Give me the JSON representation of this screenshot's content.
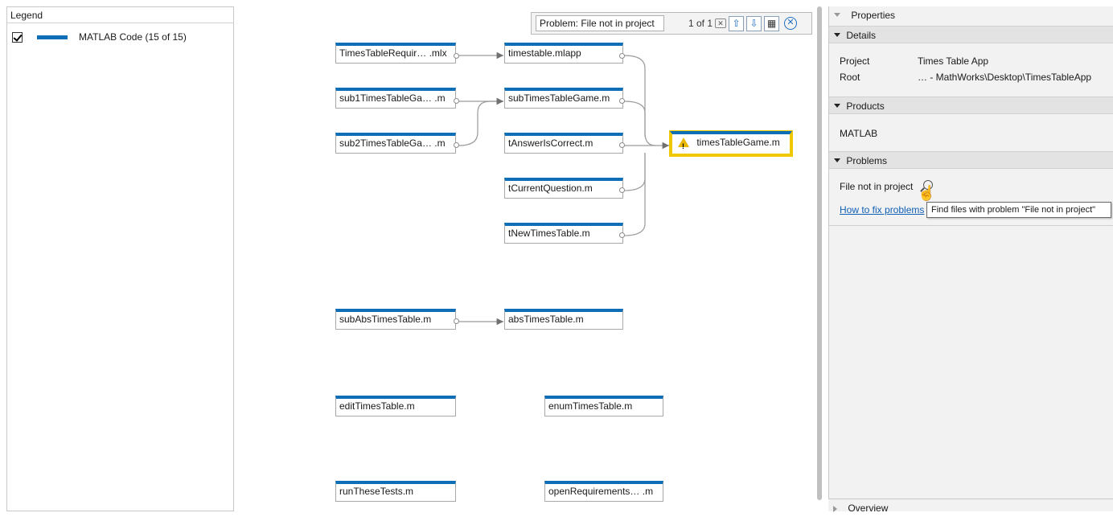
{
  "legend": {
    "title": "Legend",
    "items": [
      {
        "label": "MATLAB Code (15 of 15)",
        "checked": true,
        "color": "#0f6fb6"
      }
    ]
  },
  "graph": {
    "nodes": [
      {
        "label": "TimesTableRequir… .mlx"
      },
      {
        "label": "timestable.mlapp"
      },
      {
        "label": "sub1TimesTableGa… .m"
      },
      {
        "label": "subTimesTableGame.m"
      },
      {
        "label": "sub2TimesTableGa… .m"
      },
      {
        "label": "tAnswerIsCorrect.m"
      },
      {
        "label": "timesTableGame.m",
        "warning": true
      },
      {
        "label": "tCurrentQuestion.m"
      },
      {
        "label": "tNewTimesTable.m"
      },
      {
        "label": "subAbsTimesTable.m"
      },
      {
        "label": "absTimesTable.m"
      },
      {
        "label": "editTimesTable.m"
      },
      {
        "label": "enumTimesTable.m"
      },
      {
        "label": "runTheseTests.m"
      },
      {
        "label": "openRequirements… .m"
      }
    ],
    "node_color": "#0f6fb6",
    "highlight_color": "#f0c800"
  },
  "search": {
    "value": "Problem: File not in project",
    "count": "1 of 1",
    "icons": [
      "clear-search-icon",
      "previous-arrow-icon",
      "next-arrow-icon",
      "table-view-icon",
      "close-icon"
    ]
  },
  "properties": {
    "title": "Properties",
    "details": {
      "header": "Details",
      "project_label": "Project",
      "project_value": "Times Table App",
      "root_label": "Root",
      "root_value": "… - MathWorks\\Desktop\\TimesTableApp"
    },
    "products": {
      "header": "Products",
      "items": [
        "MATLAB"
      ]
    },
    "problems": {
      "header": "Problems",
      "problem": "File not in project",
      "fix_link": "How to fix problems"
    },
    "tooltip": "Find files with problem \"File not in project\"",
    "overview": "Overview"
  }
}
